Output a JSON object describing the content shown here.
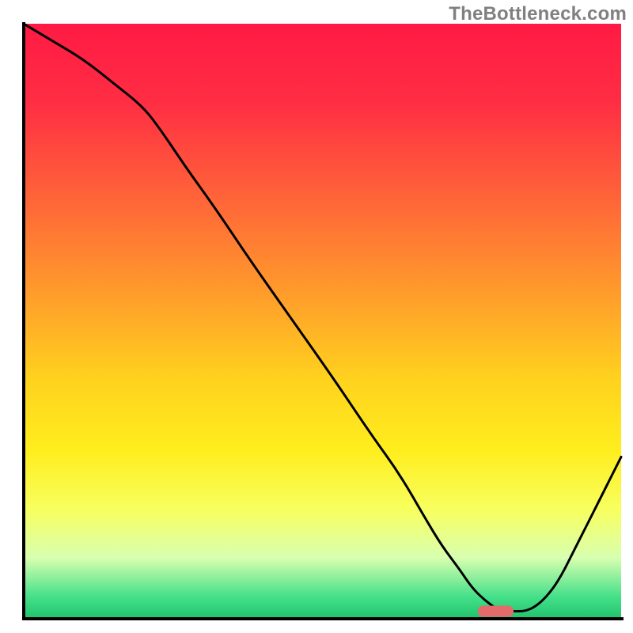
{
  "attribution": "TheBottleneck.com",
  "chart_data": {
    "type": "line",
    "title": "",
    "xlabel": "",
    "ylabel": "",
    "xlim": [
      0,
      100
    ],
    "ylim": [
      0,
      100
    ],
    "grid": false,
    "legend": false,
    "background_gradient_stops": [
      {
        "pos": 0.0,
        "color": "#ff1a44"
      },
      {
        "pos": 0.13,
        "color": "#ff2d44"
      },
      {
        "pos": 0.3,
        "color": "#ff6638"
      },
      {
        "pos": 0.46,
        "color": "#ff9e2b"
      },
      {
        "pos": 0.6,
        "color": "#ffd21e"
      },
      {
        "pos": 0.72,
        "color": "#ffee1e"
      },
      {
        "pos": 0.82,
        "color": "#f7ff60"
      },
      {
        "pos": 0.9,
        "color": "#d8ffb0"
      },
      {
        "pos": 0.965,
        "color": "#46e08a"
      },
      {
        "pos": 1.0,
        "color": "#23c56f"
      }
    ],
    "series": [
      {
        "name": "bottleneck-curve",
        "color": "#000000",
        "stroke_width": 3,
        "x": [
          0,
          5,
          10,
          15,
          20,
          23,
          27,
          32,
          38,
          45,
          52,
          58,
          63,
          67,
          70,
          73,
          75,
          77,
          79,
          80,
          82,
          84,
          86,
          88,
          90,
          92,
          94,
          96,
          100
        ],
        "y": [
          100,
          97,
          94,
          90,
          86,
          82,
          76,
          69,
          60,
          50,
          40,
          31,
          24,
          17,
          12,
          8,
          5,
          3,
          1.5,
          1,
          1,
          1,
          2,
          4,
          7,
          11,
          15,
          19,
          27
        ]
      }
    ],
    "marker": {
      "name": "optimal-zone",
      "x_start": 76,
      "x_end": 82,
      "y": 1,
      "color": "#e36b6b"
    },
    "axes": {
      "left": {
        "x": 4,
        "y1": 3,
        "y2": 100
      },
      "bottom": {
        "y": 100,
        "x1": 4,
        "x2": 100
      }
    }
  }
}
